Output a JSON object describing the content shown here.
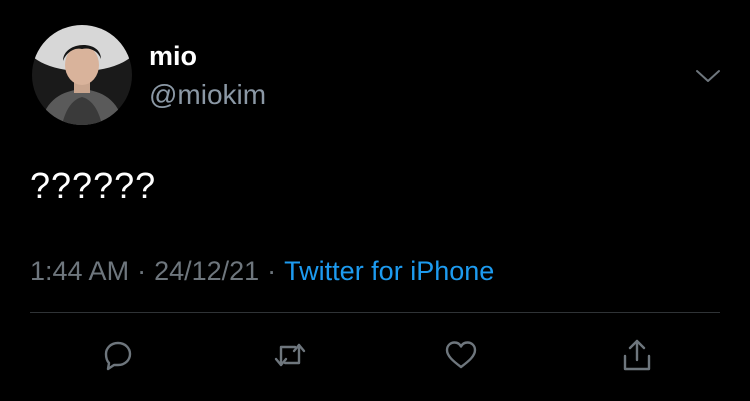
{
  "user": {
    "display_name": "mio",
    "handle": "@miokim",
    "avatar_icon": "profile-photo"
  },
  "tweet": {
    "text": "??????",
    "time": "1:44 AM",
    "date": "24/12/21",
    "separator": "·",
    "source": "Twitter for iPhone"
  },
  "actions": [
    {
      "icon": "reply-icon"
    },
    {
      "icon": "retweet-icon"
    },
    {
      "icon": "like-icon"
    },
    {
      "icon": "share-icon"
    }
  ],
  "colors": {
    "background": "#000000",
    "primary_text": "#ffffff",
    "secondary_text": "#6e767d",
    "link": "#1d9bf0",
    "divider": "#2f3336"
  }
}
